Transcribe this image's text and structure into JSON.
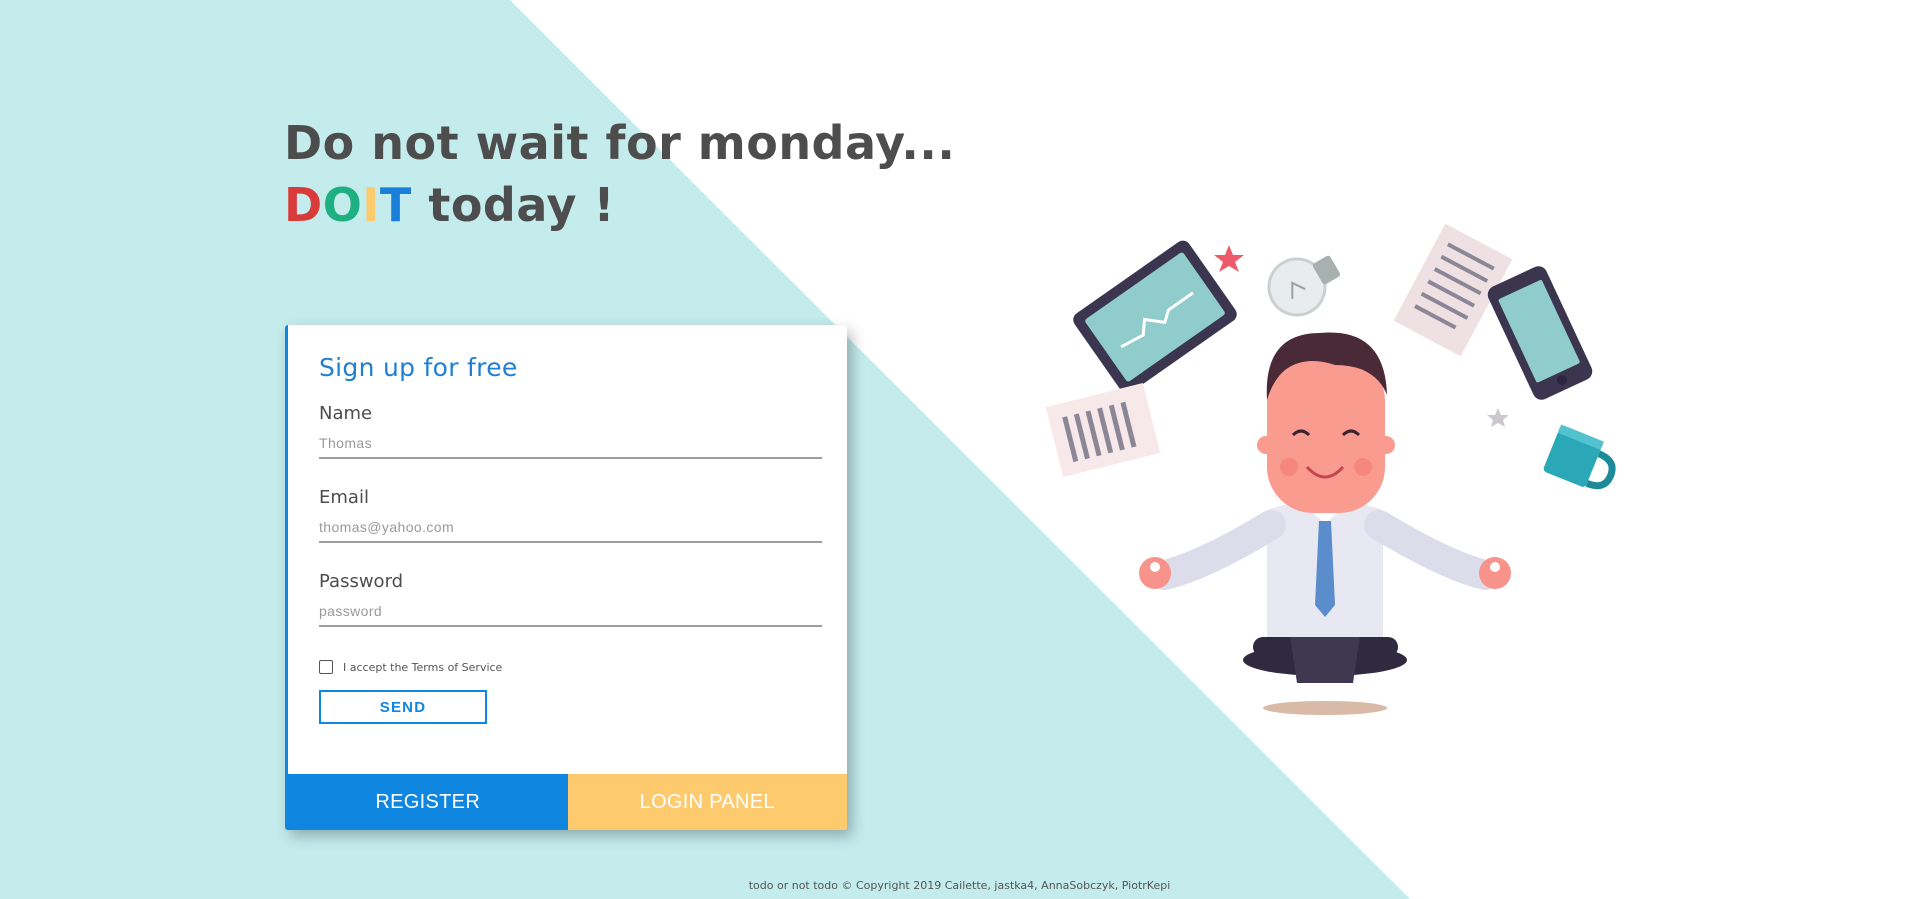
{
  "colors": {
    "background_triangle": "#c4eced",
    "headline": "#4d4d4d",
    "accent_blue": "#0f86e0",
    "accent_yellow": "#fdca6d",
    "doit_d": "#d93a3a",
    "doit_o": "#1fb082",
    "doit_i": "#fdca6d",
    "doit_t": "#1a7fd8"
  },
  "hero": {
    "line1": "Do not wait for monday...",
    "doit": [
      "D",
      "O",
      "I",
      "T"
    ],
    "line2_rest": " today !"
  },
  "form": {
    "title": "Sign up for free",
    "name": {
      "label": "Name",
      "placeholder": "Thomas"
    },
    "email": {
      "label": "Email",
      "placeholder": "thomas@yahoo.com"
    },
    "password": {
      "label": "Password",
      "placeholder": "password"
    },
    "terms_label": "I accept the Terms of Service",
    "send_label": "SEND"
  },
  "tabs": {
    "register": "REGISTER",
    "login": "LOGIN PANEL"
  },
  "illustration": {
    "icons": [
      "tablet-icon",
      "lightbulb-icon",
      "document-icon",
      "smartphone-icon",
      "mug-icon",
      "star-icon",
      "meditating-man-icon"
    ]
  },
  "footer": {
    "text": "todo or not todo © Copyright 2019 Cailette, jastka4, AnnaSobczyk, PiotrKepi"
  }
}
